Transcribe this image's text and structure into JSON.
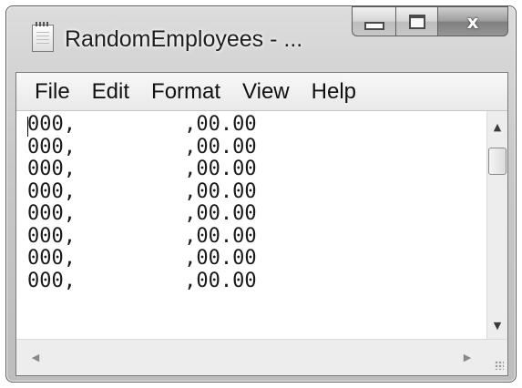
{
  "window": {
    "title": "RandomEmployees - ..."
  },
  "caption_buttons": {
    "minimize_icon": "minimize-icon",
    "maximize_icon": "maximize-icon",
    "close_icon": "close-icon",
    "close_glyph": "x"
  },
  "menu": {
    "items": [
      {
        "label": "File"
      },
      {
        "label": "Edit"
      },
      {
        "label": "Format"
      },
      {
        "label": "View"
      },
      {
        "label": "Help"
      }
    ]
  },
  "editor": {
    "lines": [
      "000,         ,00.00",
      "000,         ,00.00",
      "000,         ,00.00",
      "000,         ,00.00",
      "000,         ,00.00",
      "000,         ,00.00",
      "000,         ,00.00",
      "000,         ,00.00"
    ]
  },
  "scrollbar": {
    "up_glyph": "▲",
    "down_glyph": "▼",
    "left_glyph": "◀",
    "right_glyph": "▶"
  },
  "colors": {
    "frame": "#c9c9c9",
    "text": "#1a1a1a"
  }
}
